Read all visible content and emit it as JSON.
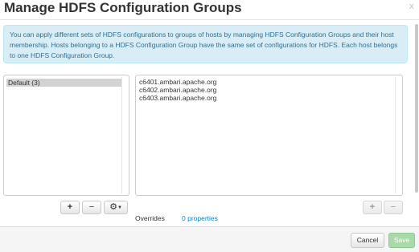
{
  "dialog": {
    "title": "Manage HDFS Configuration Groups",
    "close_label": "x",
    "info_text": "You can apply different sets of HDFS configurations to groups of hosts by managing HDFS Configuration Groups and their host membership. Hosts belonging to a HDFS Configuration Group have the same set of configurations for HDFS. Each host belongs to one HDFS Configuration Group."
  },
  "groups": {
    "items": [
      {
        "label": "Default (3)",
        "selected": true
      }
    ],
    "buttons": {
      "add": "+",
      "remove": "−",
      "settings_icon": "gear-icon"
    }
  },
  "hosts": {
    "items": [
      "c6401.ambari.apache.org",
      "c6402.ambari.apache.org",
      "c6403.ambari.apache.org"
    ],
    "buttons": {
      "add": "+",
      "remove": "−"
    }
  },
  "overrides": {
    "label": "Overrides",
    "link": "0 properties"
  },
  "footer": {
    "cancel_label": "Cancel",
    "save_label": "Save"
  },
  "colors": {
    "info_bg": "#d9edf7",
    "info_text": "#31708f",
    "link": "#0088cc",
    "save_disabled": "#a9d9a9"
  }
}
